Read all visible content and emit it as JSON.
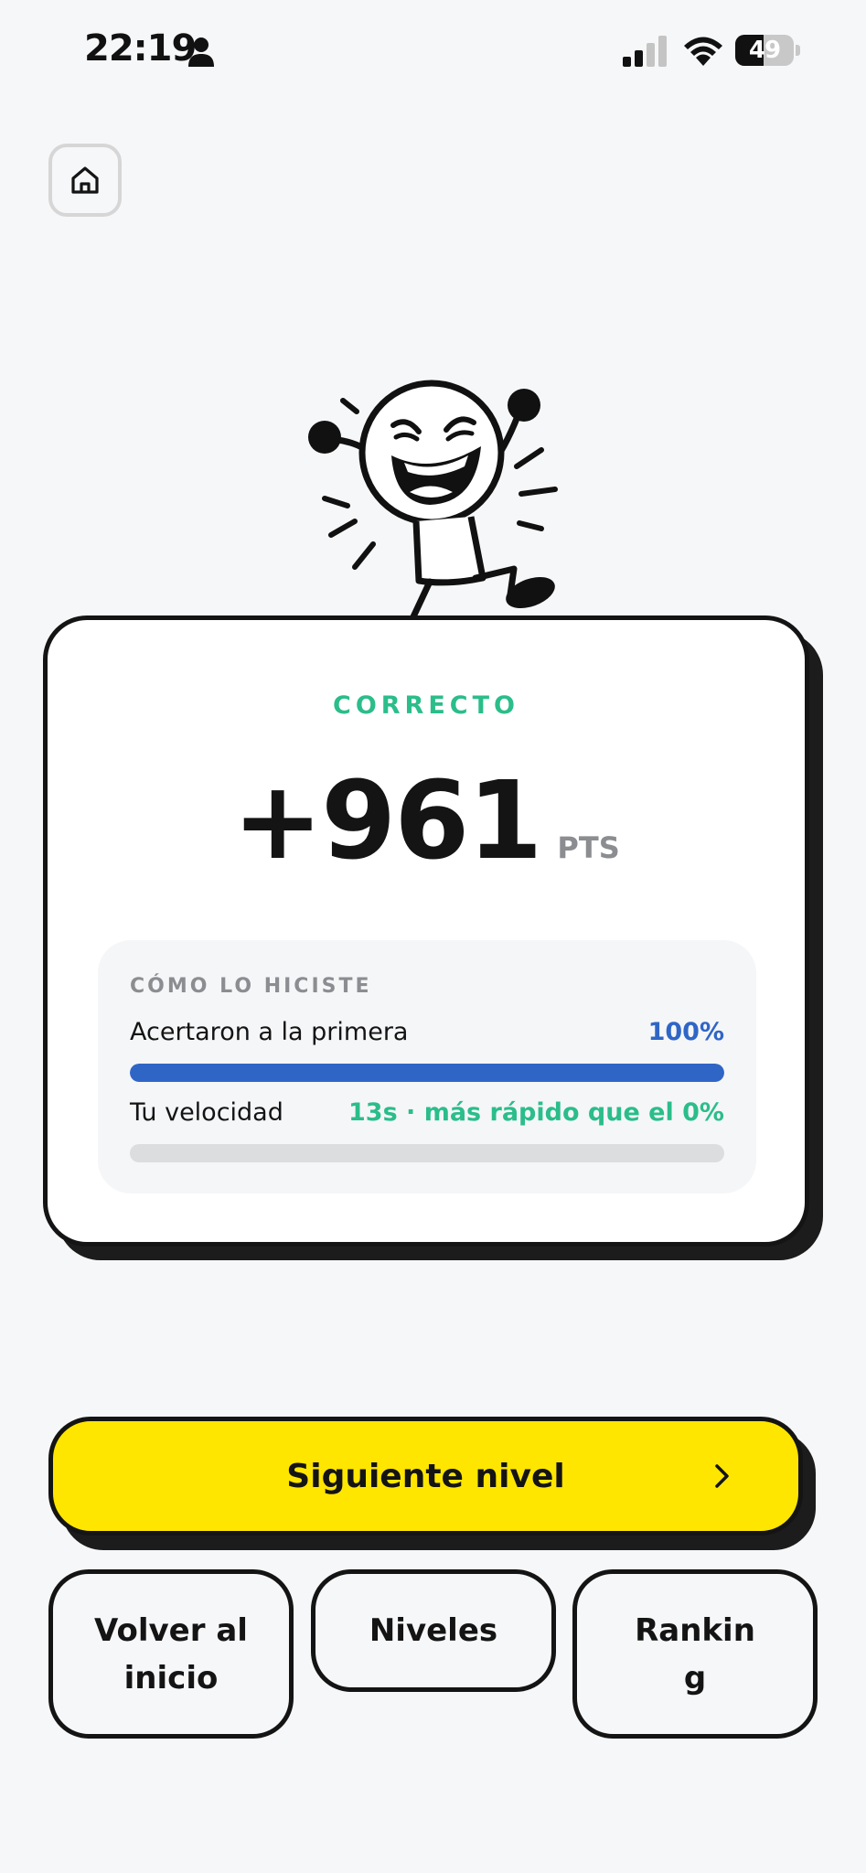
{
  "status_bar": {
    "time": "22:19",
    "battery": "49",
    "battery_level": 0.49
  },
  "home": {
    "icon": "home-icon"
  },
  "mascot": {
    "icon": "celebrating-stick-figure"
  },
  "result": {
    "verdict": "CORRECTO",
    "verdict_color": "#2bbd8a",
    "score": "+961",
    "unit": "PTS"
  },
  "stats": {
    "title": "CÓMO LO HICISTE",
    "first_try": {
      "label": "Acertaron a la primera",
      "value": "100%",
      "percent": 100,
      "color": "#2f66c6"
    },
    "speed": {
      "label": "Tu velocidad",
      "value": "13s · más rápido que el 0%",
      "percent": 0,
      "color": "#2bbd8a"
    }
  },
  "buttons": {
    "next": "Siguiente nivel",
    "next_icon": "chevron-right-icon",
    "next_color": "#ffe600",
    "home": "Volver al inicio",
    "levels": "Niveles",
    "ranking": "Ranking"
  }
}
